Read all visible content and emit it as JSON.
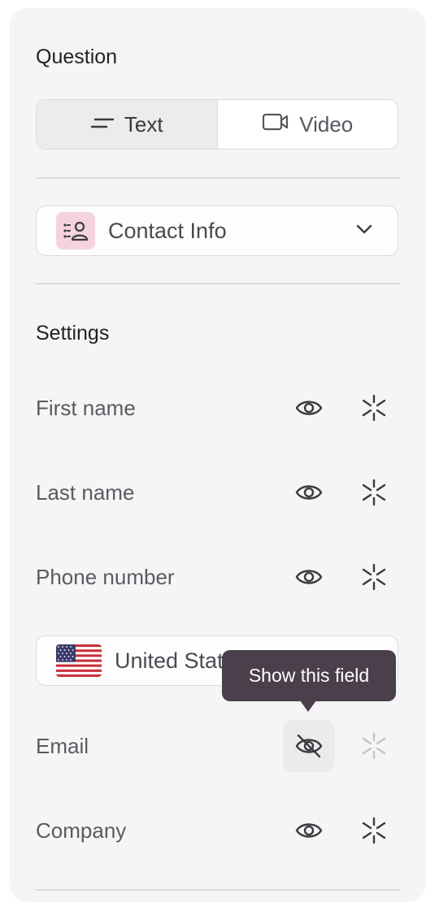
{
  "question": {
    "title": "Question",
    "toggle": [
      {
        "label": "Text",
        "icon": "text-lines-icon",
        "active": true
      },
      {
        "label": "Video",
        "icon": "video-camera-icon",
        "active": false
      }
    ],
    "type_select": {
      "label": "Contact Info",
      "icon": "contact-card-icon"
    }
  },
  "settings": {
    "title": "Settings",
    "fields": [
      {
        "label": "First name",
        "visible": true
      },
      {
        "label": "Last name",
        "visible": true
      },
      {
        "label": "Phone number",
        "visible": true
      },
      {
        "label": "Email",
        "visible": false
      },
      {
        "label": "Company",
        "visible": true
      }
    ],
    "country": {
      "label": "United States",
      "icon": "us-flag-icon"
    }
  },
  "tooltip": {
    "text": "Show this field"
  },
  "colors": {
    "panel_bg": "#f5f5f5",
    "badge_bg": "#f4d3dc",
    "tooltip_bg": "#4a3f4b",
    "border": "#dcdcdc"
  }
}
